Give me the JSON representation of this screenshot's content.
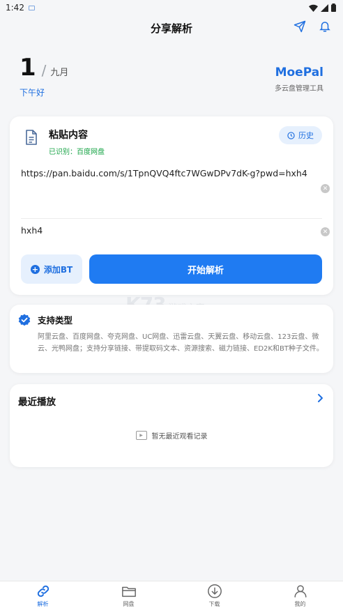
{
  "status": {
    "time": "1:42"
  },
  "header": {
    "title": "分享解析"
  },
  "date": {
    "day": "1",
    "month": "九月",
    "greeting": "下午好"
  },
  "brand": {
    "name": "MoePal",
    "tagline": "多云盘管理工具"
  },
  "paste": {
    "title": "粘贴内容",
    "detected": "已识别：百度网盘",
    "history_label": "历史",
    "url_value": "https://pan.baidu.com/s/1TpnQVQ4ftc7WGwDPv7dK-g?pwd=hxh4",
    "password_value": "hxh4",
    "add_bt_label": "添加BT",
    "start_label": "开始解析"
  },
  "support": {
    "title": "支持类型",
    "text": "阿里云盘、百度网盘、夸克网盘、UC网盘、迅雷云盘、天翼云盘、移动云盘、123云盘、微云、光鸭网盘；支持分享链接、带提取码文本、资源搜索、磁力链接、ED2K和BT种子文件。"
  },
  "recent": {
    "title": "最近播放",
    "empty_text": "暂无最近观看记录"
  },
  "watermark": {
    "logo": "K73",
    "site": "游戏之家"
  },
  "nav": [
    {
      "label": "解析",
      "icon": "link-icon"
    },
    {
      "label": "网盘",
      "icon": "folder-icon"
    },
    {
      "label": "下载",
      "icon": "download-icon"
    },
    {
      "label": "我的",
      "icon": "user-icon"
    }
  ],
  "colors": {
    "accent": "#1f6fe0",
    "primary_button": "#1f7bf2",
    "success": "#19a447"
  }
}
